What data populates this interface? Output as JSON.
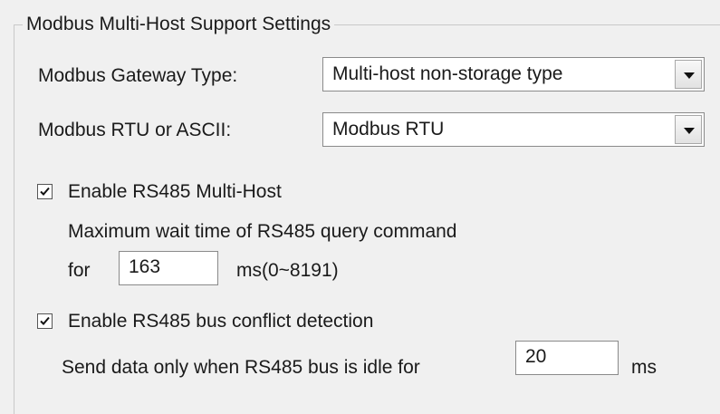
{
  "group": {
    "title": "Modbus Multi-Host Support Settings"
  },
  "gateway_type": {
    "label": "Modbus Gateway Type:",
    "selected": "Multi-host non-storage type"
  },
  "rtu_ascii": {
    "label": "Modbus RTU or ASCII:",
    "selected": "Modbus RTU"
  },
  "multi_host": {
    "checkbox_label": "Enable RS485 Multi-Host",
    "checked": true,
    "wait_text": "Maximum wait time of RS485  query command",
    "for_label": "for",
    "wait_value": "163",
    "range_text": "ms(0~8191)"
  },
  "bus_conflict": {
    "checkbox_label": "Enable RS485 bus conflict detection",
    "checked": true,
    "idle_text": "Send data only when RS485 bus is idle for",
    "idle_value": "20",
    "unit": "ms"
  },
  "icons": {
    "dropdown": "chevron-down-icon",
    "check": "checkmark-icon"
  }
}
